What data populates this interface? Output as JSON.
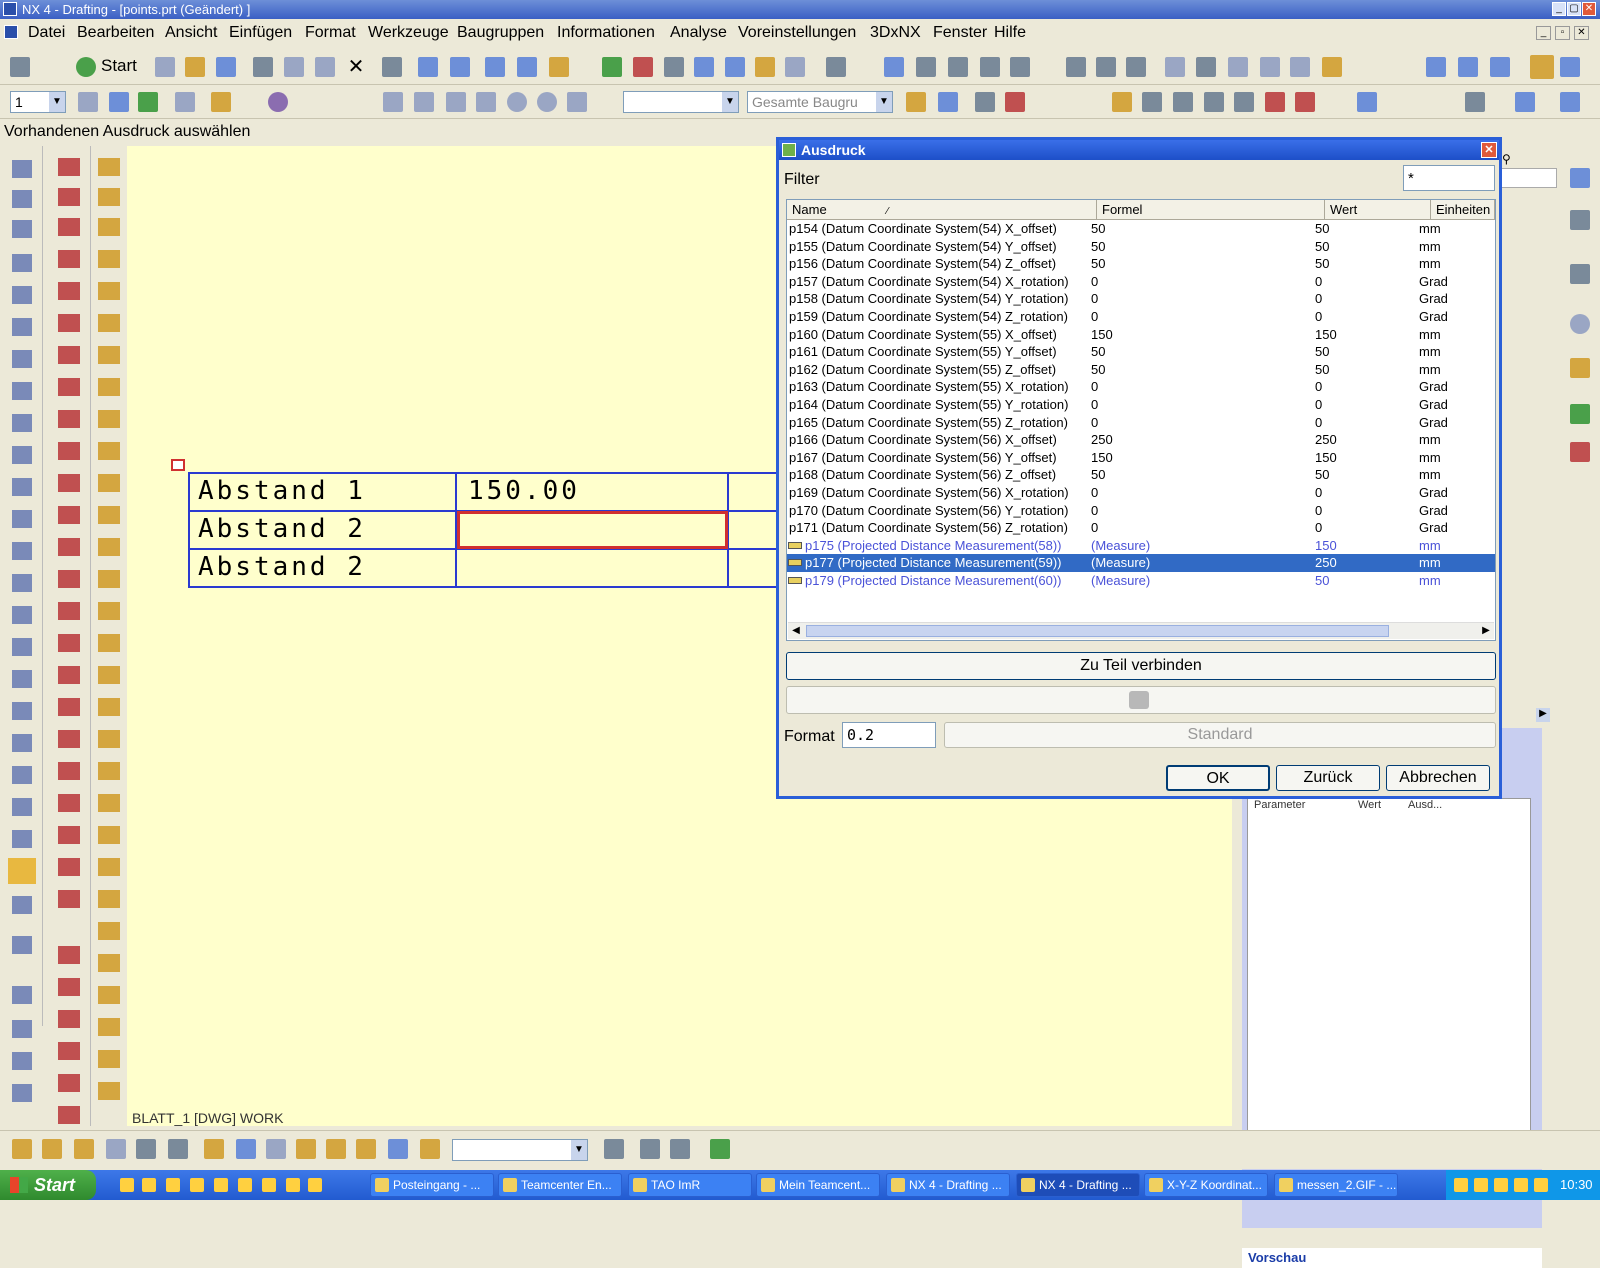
{
  "window": {
    "title": "NX 4 - Drafting - [points.prt (Geändert) ]",
    "icon": "nx-app-icon",
    "controls": [
      "_",
      "▢",
      "✕"
    ]
  },
  "menu": [
    "Datei",
    "Bearbeiten",
    "Ansicht",
    "Einfügen",
    "Format",
    "Werkzeuge",
    "Baugruppen",
    "Informationen",
    "Analyse",
    "Voreinstellungen",
    "3DxNX",
    "Fenster",
    "Hilfe"
  ],
  "toolbar": {
    "start_label": "Start",
    "layer_combo": "1",
    "assembly_combo": "Gesamte Baugru"
  },
  "status_prompt": "Vorhandenen Ausdruck auswählen",
  "drawing": {
    "sheet_label": "BLATT_1 [DWG] WORK",
    "table_rows": [
      {
        "label": "Abstand 1",
        "value": "150.00"
      },
      {
        "label": "Abstand 2",
        "value": ""
      },
      {
        "label": "Abstand 2",
        "value": ""
      }
    ]
  },
  "dialog": {
    "title": "Ausdruck",
    "filter_label": "Filter",
    "filter_value": "*",
    "columns": [
      "Name",
      "Formel",
      "Wert",
      "Einheiten"
    ],
    "rows": [
      {
        "name": "p154  (Datum Coordinate System(54) X_offset)",
        "formula": "50",
        "value": "50",
        "unit": "mm",
        "type": "param"
      },
      {
        "name": "p155  (Datum Coordinate System(54) Y_offset)",
        "formula": "50",
        "value": "50",
        "unit": "mm",
        "type": "param"
      },
      {
        "name": "p156  (Datum Coordinate System(54) Z_offset)",
        "formula": "50",
        "value": "50",
        "unit": "mm",
        "type": "param"
      },
      {
        "name": "p157  (Datum Coordinate System(54) X_rotation)",
        "formula": "0",
        "value": "0",
        "unit": "Grad",
        "type": "param"
      },
      {
        "name": "p158  (Datum Coordinate System(54) Y_rotation)",
        "formula": "0",
        "value": "0",
        "unit": "Grad",
        "type": "param"
      },
      {
        "name": "p159  (Datum Coordinate System(54) Z_rotation)",
        "formula": "0",
        "value": "0",
        "unit": "Grad",
        "type": "param"
      },
      {
        "name": "p160  (Datum Coordinate System(55) X_offset)",
        "formula": "150",
        "value": "150",
        "unit": "mm",
        "type": "param"
      },
      {
        "name": "p161  (Datum Coordinate System(55) Y_offset)",
        "formula": "50",
        "value": "50",
        "unit": "mm",
        "type": "param"
      },
      {
        "name": "p162  (Datum Coordinate System(55) Z_offset)",
        "formula": "50",
        "value": "50",
        "unit": "mm",
        "type": "param"
      },
      {
        "name": "p163  (Datum Coordinate System(55) X_rotation)",
        "formula": "0",
        "value": "0",
        "unit": "Grad",
        "type": "param"
      },
      {
        "name": "p164  (Datum Coordinate System(55) Y_rotation)",
        "formula": "0",
        "value": "0",
        "unit": "Grad",
        "type": "param"
      },
      {
        "name": "p165  (Datum Coordinate System(55) Z_rotation)",
        "formula": "0",
        "value": "0",
        "unit": "Grad",
        "type": "param"
      },
      {
        "name": "p166  (Datum Coordinate System(56) X_offset)",
        "formula": "250",
        "value": "250",
        "unit": "mm",
        "type": "param"
      },
      {
        "name": "p167  (Datum Coordinate System(56) Y_offset)",
        "formula": "150",
        "value": "150",
        "unit": "mm",
        "type": "param"
      },
      {
        "name": "p168  (Datum Coordinate System(56) Z_offset)",
        "formula": "50",
        "value": "50",
        "unit": "mm",
        "type": "param"
      },
      {
        "name": "p169  (Datum Coordinate System(56) X_rotation)",
        "formula": "0",
        "value": "0",
        "unit": "Grad",
        "type": "param"
      },
      {
        "name": "p170  (Datum Coordinate System(56) Y_rotation)",
        "formula": "0",
        "value": "0",
        "unit": "Grad",
        "type": "param"
      },
      {
        "name": "p171  (Datum Coordinate System(56) Z_rotation)",
        "formula": "0",
        "value": "0",
        "unit": "Grad",
        "type": "param"
      },
      {
        "name": "p175  (Projected Distance Measurement(58))",
        "formula": "(Measure)",
        "value": "150",
        "unit": "mm",
        "type": "measure"
      },
      {
        "name": "p177  (Projected Distance Measurement(59))",
        "formula": "(Measure)",
        "value": "250",
        "unit": "mm",
        "type": "measure-selected"
      },
      {
        "name": "p179  (Projected Distance Measurement(60))",
        "formula": "(Measure)",
        "value": "50",
        "unit": "mm",
        "type": "measure"
      }
    ],
    "link_button": "Zu Teil verbinden",
    "format_label": "Format",
    "format_value": "0.2",
    "standard_button": "Standard",
    "ok_button": "OK",
    "back_button": "Zurück",
    "cancel_button": "Abbrechen"
  },
  "right_panel": {
    "table_headers": [
      "Parameter",
      "Wert",
      "Ausd..."
    ],
    "preview_label": "Vorschau"
  },
  "taskbar": {
    "start_label": "Start",
    "tasks": [
      {
        "label": "Posteingang - ...",
        "active": false
      },
      {
        "label": "Teamcenter En...",
        "active": false
      },
      {
        "label": "TAO ImR",
        "active": false
      },
      {
        "label": "Mein Teamcent...",
        "active": false
      },
      {
        "label": "NX 4 - Drafting ...",
        "active": false
      },
      {
        "label": "NX 4 - Drafting ...",
        "active": true
      },
      {
        "label": "X-Y-Z Koordinat...",
        "active": false
      },
      {
        "label": "messen_2.GIF - ...",
        "active": false
      }
    ],
    "clock": "10:30"
  },
  "colors": {
    "titlebar": "#3a5fc4",
    "canvas": "#ffffcc",
    "table_border": "#2a3ad0",
    "highlight_cell": "#d03030",
    "measure_text": "#4a52d8",
    "selection": "#316ac5"
  }
}
